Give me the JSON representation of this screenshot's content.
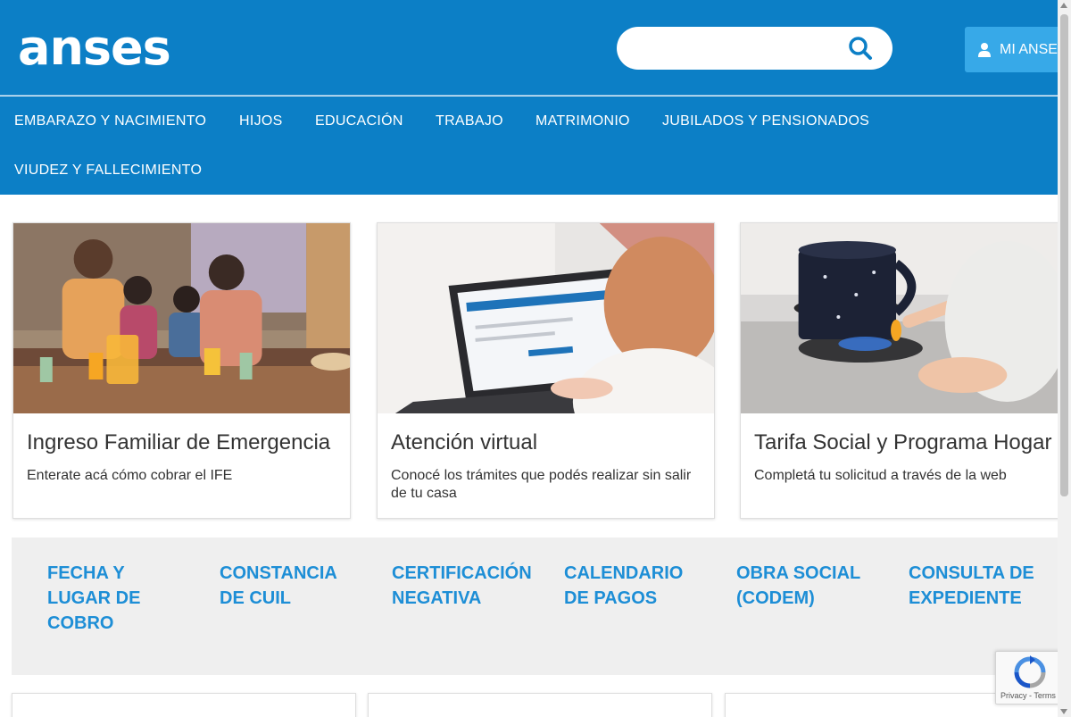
{
  "header": {
    "logo": "anses",
    "search_placeholder": "",
    "account_button": "MI ANSES"
  },
  "nav": {
    "items": [
      "EMBARAZO Y NACIMIENTO",
      "HIJOS",
      "EDUCACIÓN",
      "TRABAJO",
      "MATRIMONIO",
      "JUBILADOS Y PENSIONADOS",
      "VIUDEZ Y FALLECIMIENTO"
    ]
  },
  "cards": [
    {
      "title": "Ingreso Familiar de Emergencia",
      "text": "Enterate acá cómo cobrar el IFE"
    },
    {
      "title": "Atención virtual",
      "text": "Conocé los trámites que podés realizar sin salir de tu casa"
    },
    {
      "title": "Tarifa Social y Programa Hogar",
      "text": "Completá tu solicitud a través de la web"
    }
  ],
  "quick_links": [
    "FECHA Y LUGAR DE COBRO",
    "CONSTANCIA DE CUIL",
    "CERTIFICACIÓN NEGATIVA",
    "CALENDARIO DE PAGOS",
    "OBRA SOCIAL (CODEM)",
    "CONSULTA DE EXPEDIENTE"
  ],
  "recaptcha": {
    "text": "Privacy - Terms"
  },
  "colors": {
    "brand": "#0c7fc6",
    "accent": "#37a9e8",
    "link": "#1d8ed6",
    "band": "#efefef"
  },
  "icons": {
    "search": "search-icon",
    "user": "user-icon"
  }
}
